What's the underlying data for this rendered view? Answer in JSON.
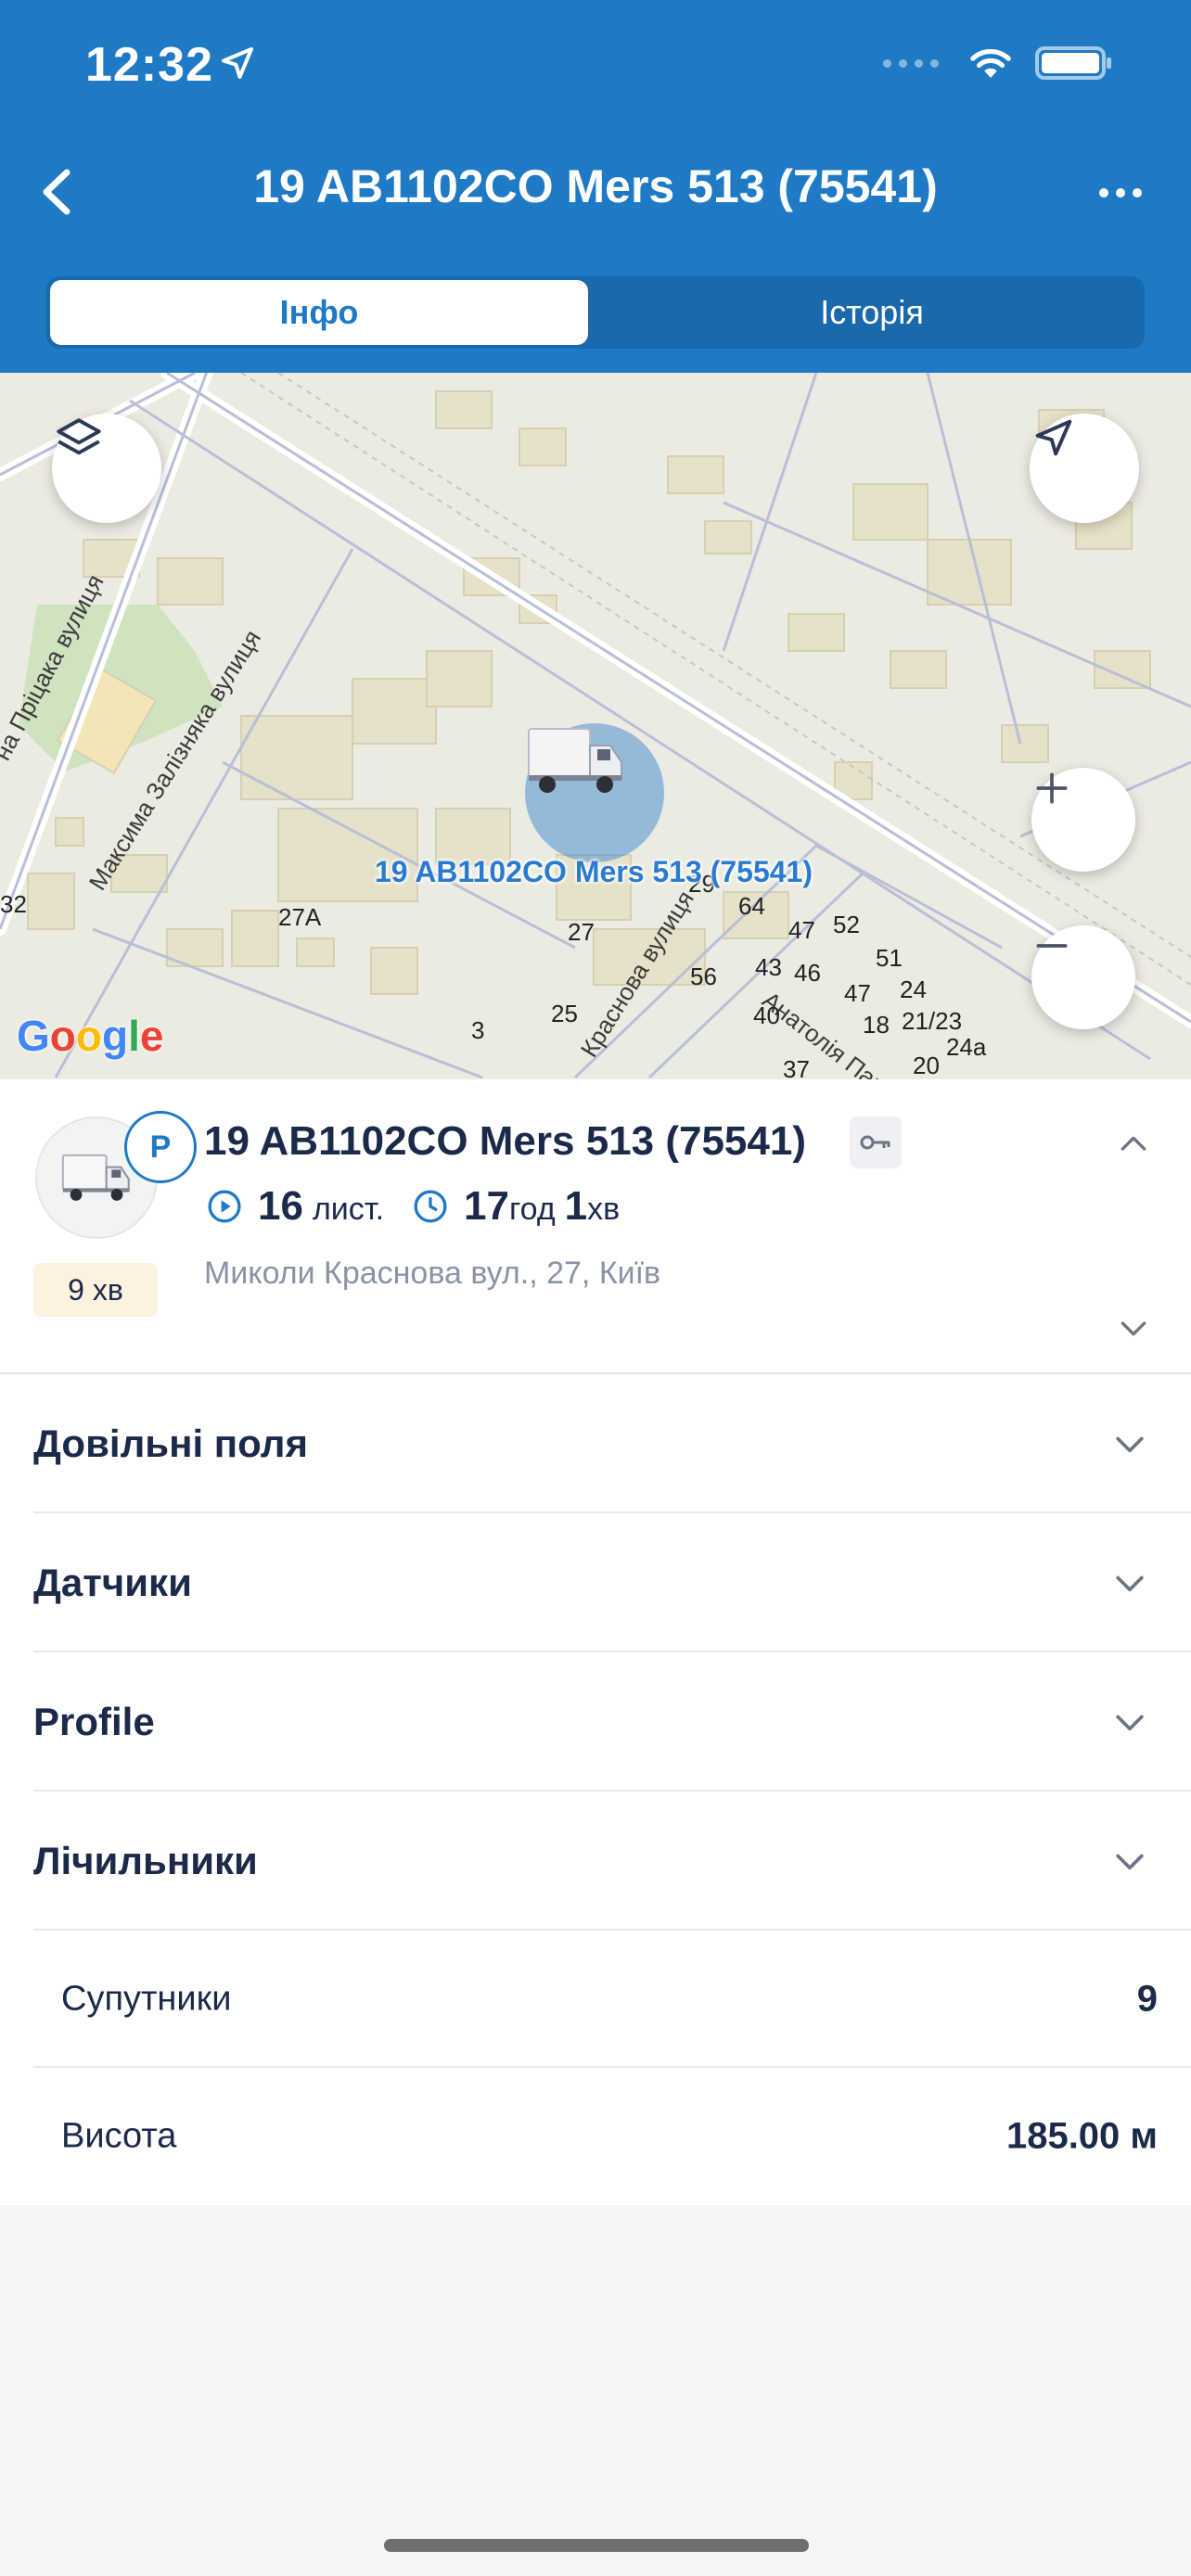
{
  "status_bar": {
    "time": "12:32"
  },
  "header": {
    "title": "19 AB1102CO Mers 513 (75541)",
    "tabs": [
      {
        "label": "Інфо",
        "active": true
      },
      {
        "label": "Історія",
        "active": false
      }
    ]
  },
  "map": {
    "marker_label": "19 AB1102CO Mers 513 (75541)",
    "street_labels": [
      "Максима Залізняка вулиця",
      "Пріцака вулиця",
      "Краснова вулиця",
      "Анатолія Пант..."
    ],
    "house_numbers": [
      "27A",
      "27",
      "25",
      "3",
      "29",
      "64",
      "47",
      "52",
      "51",
      "43",
      "46",
      "56",
      "24",
      "47",
      "40",
      "18",
      "21/23",
      "24a",
      "20",
      "37",
      "32"
    ],
    "attribution": "Google"
  },
  "unit": {
    "name": "19 AB1102CO Mers 513 (75541)",
    "badge": "P",
    "since": "9 хв",
    "trips_value": "16",
    "trips_unit": "лист.",
    "duration_hours": "17",
    "duration_hours_unit": "год",
    "duration_minutes": "1",
    "duration_minutes_unit": "хв",
    "address": "Миколи Краснова вул., 27, Київ"
  },
  "sections": [
    {
      "title": "Довільні поля"
    },
    {
      "title": "Датчики"
    },
    {
      "title": "Profile"
    },
    {
      "title": "Лічильники"
    }
  ],
  "counters": [
    {
      "label": "Супутники",
      "value": "9"
    },
    {
      "label": "Висота",
      "value": "185.00 м"
    }
  ],
  "colors": {
    "header_bg": "#1f7ac6",
    "accent": "#1f7ac6",
    "badge_bg": "#fdf1e0"
  }
}
